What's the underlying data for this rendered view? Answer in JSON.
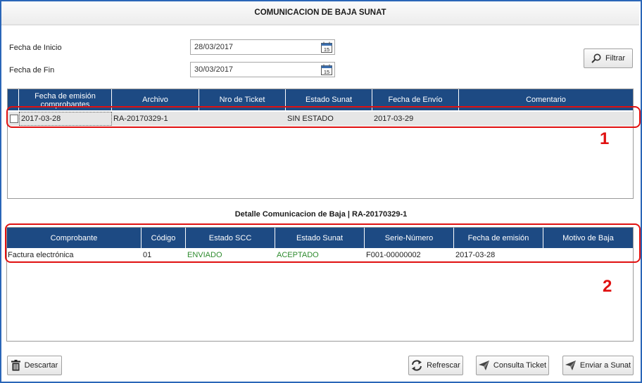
{
  "window": {
    "title": "COMUNICACION DE BAJA SUNAT"
  },
  "filters": {
    "start_label": "Fecha de Inicio",
    "start_value": "28/03/2017",
    "end_label": "Fecha de Fin",
    "end_value": "30/03/2017",
    "filter_button": "Filtrar",
    "calendar_icon_text": "15"
  },
  "grid1": {
    "headers": [
      "Fecha de emisión comprobantes",
      "Archivo",
      "Nro de Ticket",
      "Estado Sunat",
      "Fecha de Envío",
      "Comentario"
    ],
    "rows": [
      {
        "fecha_emision": "2017-03-28",
        "archivo": "RA-20170329-1",
        "ticket": "",
        "estado": "SIN ESTADO",
        "fecha_envio": "2017-03-29",
        "comentario": ""
      }
    ]
  },
  "detail_title": "Detalle Comunicacion de Baja | RA-20170329-1",
  "grid2": {
    "headers": [
      "Comprobante",
      "Código",
      "Estado SCC",
      "Estado Sunat",
      "Serie-Número",
      "Fecha de emisión",
      "Motivo de Baja"
    ],
    "rows": [
      {
        "comprobante": "Factura electrónica",
        "codigo": "01",
        "estado_scc": "ENVIADO",
        "estado_sunat": "ACEPTADO",
        "serie_numero": "F001-00000002",
        "fecha_emision": "2017-03-28",
        "motivo": ""
      }
    ]
  },
  "annotations": {
    "marker1": "1",
    "marker2": "2"
  },
  "buttons": {
    "descartar": "Descartar",
    "refrescar": "Refrescar",
    "consulta": "Consulta Ticket",
    "enviar": "Enviar a Sunat"
  },
  "colors": {
    "header_bg": "#1d4a83",
    "status_green": "#2e8b2e",
    "annotation_red": "#e01010",
    "frame_blue": "#2a66b8"
  },
  "icons": {
    "filter": "search-icon",
    "discard": "trash-icon",
    "refresh": "refresh-icon",
    "send": "send-icon",
    "calendar": "calendar-icon"
  }
}
